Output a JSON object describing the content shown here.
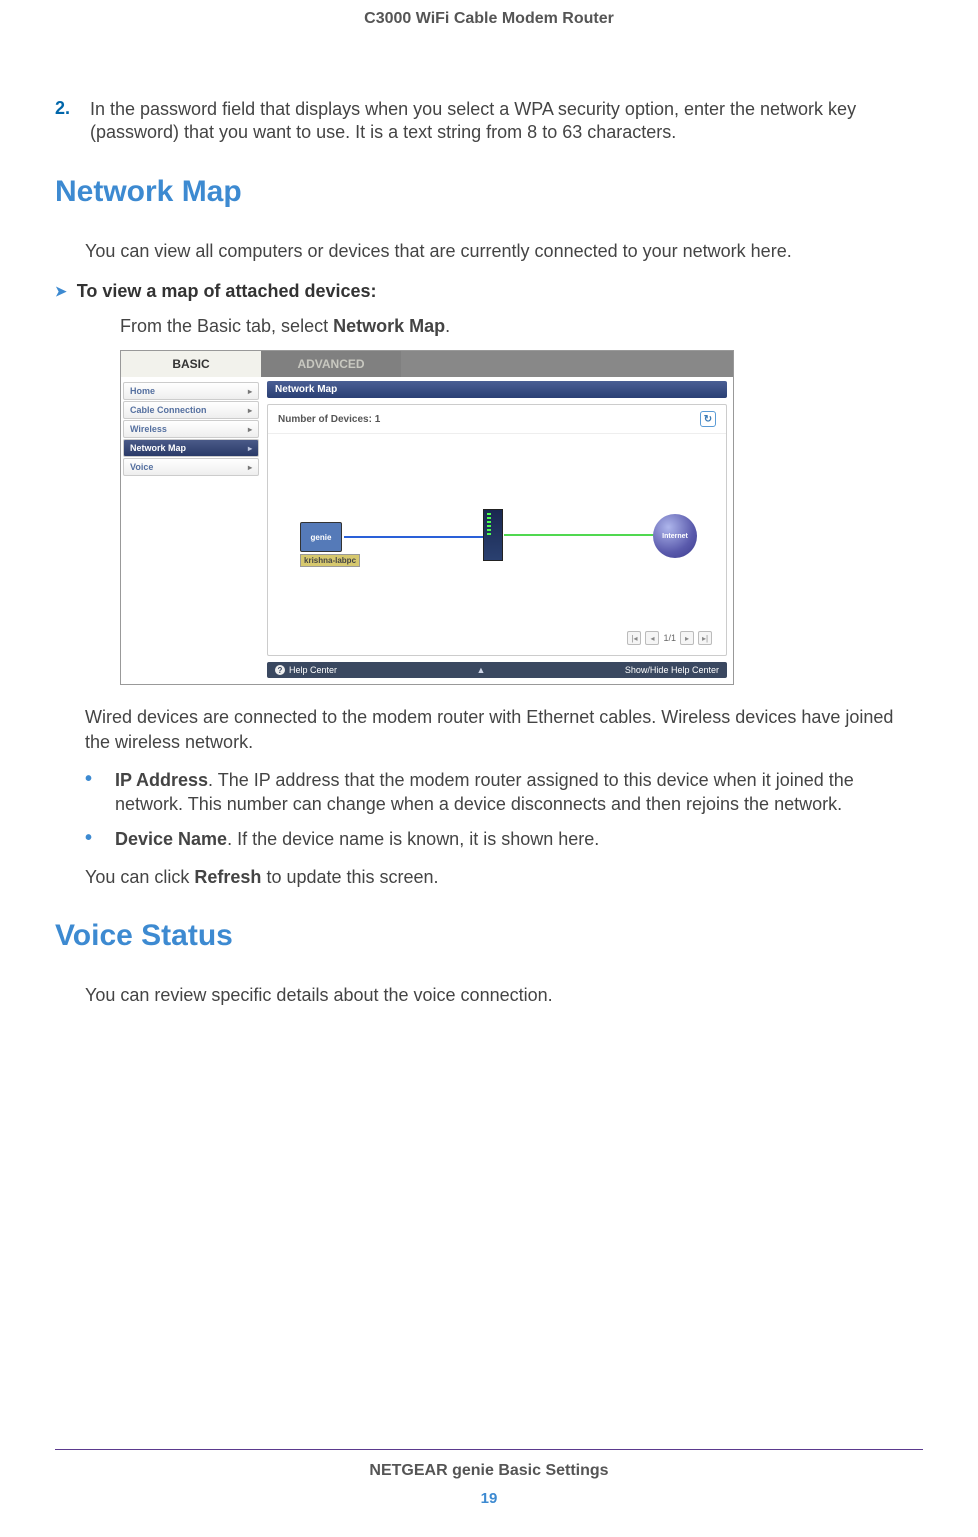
{
  "header": "C3000 WiFi Cable Modem Router",
  "step2": {
    "num": "2.",
    "text": "In the password field that displays when you select a WPA security option, enter the network key (password) that you want to use. It is a text string from 8 to 63 characters."
  },
  "section_network_map": "Network Map",
  "nm_intro": "You can view all computers or devices that are currently connected to your network here.",
  "nm_task_head": "To view a map of attached devices:",
  "nm_task_body_a": "From the Basic tab, select ",
  "nm_task_body_b": "Network Map",
  "nm_task_body_c": ".",
  "screenshot": {
    "tabs": {
      "basic": "BASIC",
      "advanced": "ADVANCED"
    },
    "sidebar": {
      "items": [
        {
          "label": "Home"
        },
        {
          "label": "Cable Connection"
        },
        {
          "label": "Wireless"
        },
        {
          "label": "Network Map",
          "active": true
        },
        {
          "label": "Voice"
        }
      ]
    },
    "panel_title": "Network Map",
    "device_count_label": "Number of Devices: 1",
    "pc_genie": "genie",
    "pc_name": "krishna-labpc",
    "globe_label": "Internet",
    "pager": "1/1",
    "help_left": "Help Center",
    "help_right": "Show/Hide Help Center"
  },
  "nm_after": "Wired devices are connected to the modem router with Ethernet cables. Wireless devices have joined the wireless network.",
  "bullets": {
    "ip_head": "IP Address",
    "ip_body": ". The IP address that the modem router assigned to this device when it joined the network. This number can change when a device disconnects and then rejoins the network.",
    "dn_head": "Device Name",
    "dn_body": ". If the device name is known, it is shown here."
  },
  "refresh_a": "You can click ",
  "refresh_b": "Refresh",
  "refresh_c": " to update this screen.",
  "section_voice": "Voice Status",
  "voice_intro": "You can review specific details about the voice connection.",
  "footer_title": "NETGEAR genie Basic Settings",
  "footer_page": "19"
}
